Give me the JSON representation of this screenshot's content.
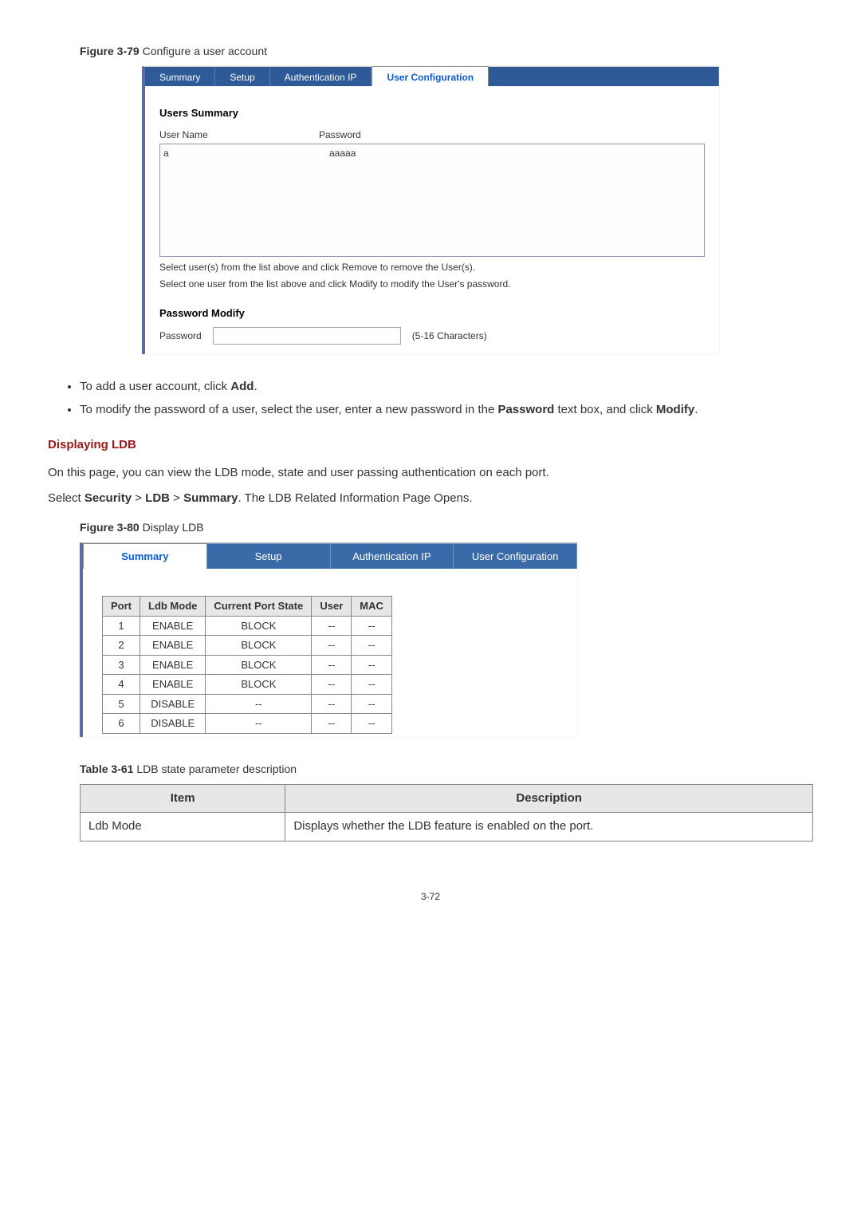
{
  "figure79": {
    "label": "Figure 3-79",
    "caption": "Configure a user account",
    "tabs": [
      "Summary",
      "Setup",
      "Authentication IP",
      "User Configuration"
    ],
    "activeTab": "User Configuration",
    "usersSummaryTitle": "Users Summary",
    "colUserName": "User Name",
    "colPassword": "Password",
    "rowUser": "a",
    "rowPass": "aaaaa",
    "hint1": "Select user(s) from the list above and click Remove to remove the User(s).",
    "hint2": "Select one user from the list above and click Modify to modify the User's password.",
    "pwModifyTitle": "Password Modify",
    "pwLabel": "Password",
    "pwNote": "(5-16 Characters)"
  },
  "bullets": {
    "b1_pre": "To add a user account, click ",
    "b1_bold": "Add",
    "b1_post": ".",
    "b2_pre": "To modify the password of a user, select the user, enter a new password in the ",
    "b2_bold1": "Password",
    "b2_mid": " text box, and click ",
    "b2_bold2": "Modify",
    "b2_post": "."
  },
  "section": {
    "heading": "Displaying LDB",
    "p1": "On this page, you can view the LDB mode, state and user passing authentication on each port.",
    "p2_pre": "Select ",
    "p2_b1": "Security",
    "p2_gt1": " > ",
    "p2_b2": "LDB",
    "p2_gt2": " > ",
    "p2_b3": "Summary",
    "p2_post": ". The LDB Related Information Page Opens."
  },
  "figure80": {
    "label": "Figure 3-80",
    "caption": "Display LDB",
    "tabs": [
      "Summary",
      "Setup",
      "Authentication IP",
      "User Configuration"
    ],
    "activeTab": "Summary",
    "headers": [
      "Port",
      "Ldb Mode",
      "Current Port State",
      "User",
      "MAC"
    ],
    "rows": [
      {
        "port": "1",
        "mode": "ENABLE",
        "state": "BLOCK",
        "user": "--",
        "mac": "--"
      },
      {
        "port": "2",
        "mode": "ENABLE",
        "state": "BLOCK",
        "user": "--",
        "mac": "--"
      },
      {
        "port": "3",
        "mode": "ENABLE",
        "state": "BLOCK",
        "user": "--",
        "mac": "--"
      },
      {
        "port": "4",
        "mode": "ENABLE",
        "state": "BLOCK",
        "user": "--",
        "mac": "--"
      },
      {
        "port": "5",
        "mode": "DISABLE",
        "state": "--",
        "user": "--",
        "mac": "--"
      },
      {
        "port": "6",
        "mode": "DISABLE",
        "state": "--",
        "user": "--",
        "mac": "--"
      }
    ]
  },
  "table61": {
    "label": "Table 3-61",
    "caption": "LDB state parameter description",
    "hItem": "Item",
    "hDesc": "Description",
    "row1Item": "Ldb Mode",
    "row1Desc": "Displays whether the LDB feature is enabled on the port."
  },
  "pageNumber": "3-72"
}
